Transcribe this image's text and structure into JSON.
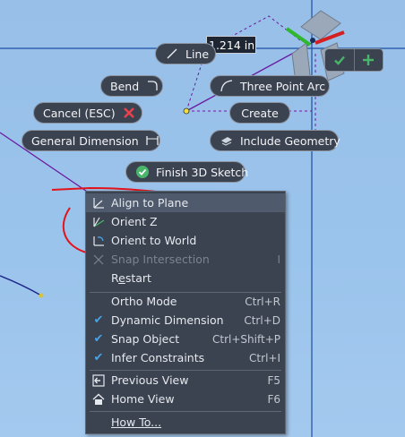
{
  "dimension_input": {
    "value": "1.214 in"
  },
  "pills": {
    "line": "Line",
    "bend": "Bend",
    "three_point_arc": "Three Point Arc",
    "cancel": "Cancel (ESC)",
    "create": "Create",
    "general_dimension": "General Dimension",
    "include_geometry": "Include Geometry",
    "finish_3d_sketch": "Finish 3D Sketch"
  },
  "menu": {
    "align_to_plane": "Align to Plane",
    "orient_z": "Orient Z",
    "orient_to_world": "Orient to World",
    "snap_intersection": "Snap Intersection",
    "snap_intersection_shortcut": "I",
    "restart_prefix": "R",
    "restart_underlined": "e",
    "restart_suffix": "start",
    "ortho_mode": "Ortho Mode",
    "ortho_mode_shortcut": "Ctrl+R",
    "dynamic_dimension": "Dynamic Dimension",
    "dynamic_dimension_shortcut": "Ctrl+D",
    "snap_object": "Snap Object",
    "snap_object_shortcut": "Ctrl+Shift+P",
    "infer_constraints": "Infer Constraints",
    "infer_constraints_shortcut": "Ctrl+I",
    "previous_view": "Previous View",
    "previous_view_shortcut": "F5",
    "home_view": "Home View",
    "home_view_shortcut": "F6",
    "how_to": "How To..."
  },
  "colors": {
    "accent_check": "#47a3e6",
    "ok_green": "#48b56a",
    "cancel_red": "#e5424d",
    "annotation_red": "#e3131b"
  }
}
